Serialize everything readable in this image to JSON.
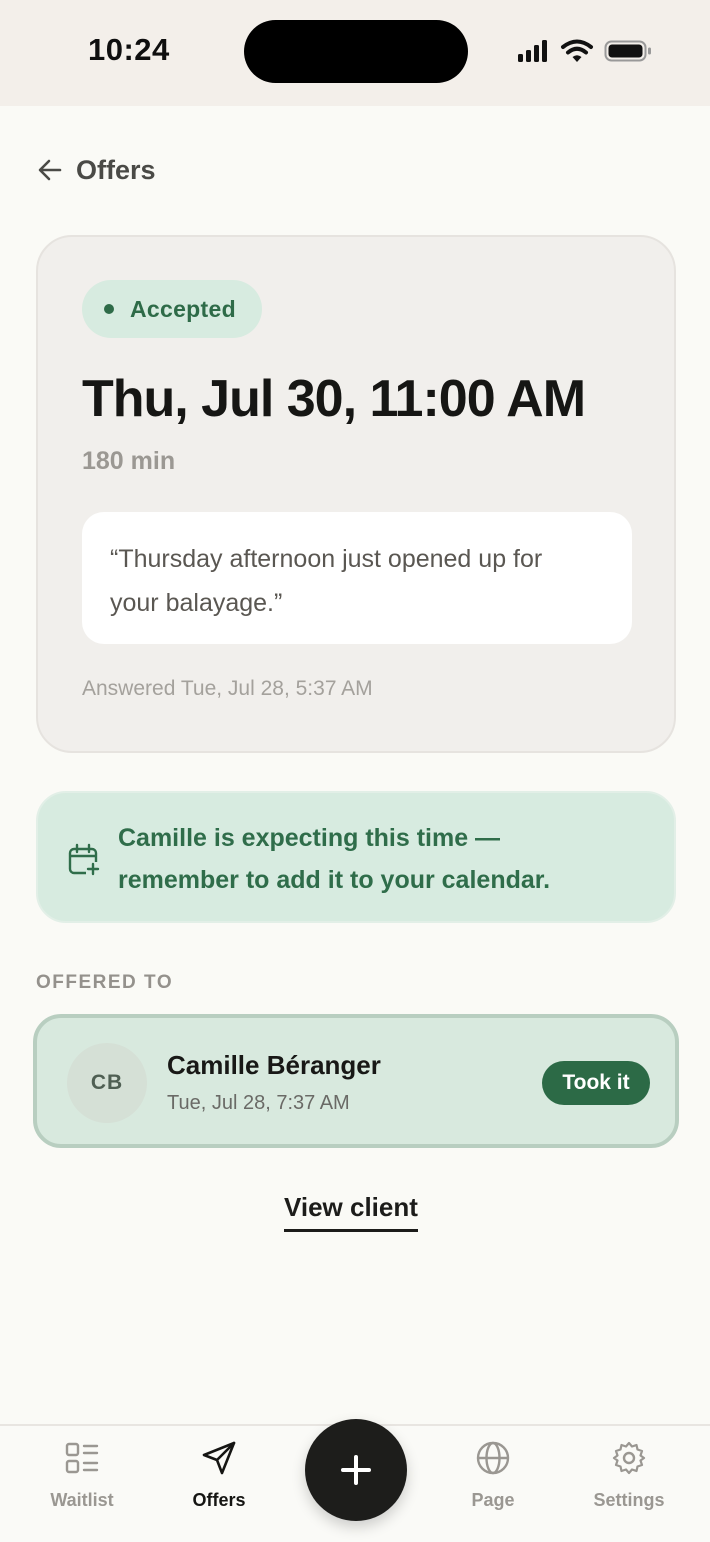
{
  "status_bar": {
    "time": "10:24",
    "icons": [
      "signal-icon",
      "wifi-icon",
      "battery-icon"
    ]
  },
  "nav": {
    "back_label": "Offers"
  },
  "offer": {
    "status": "Accepted",
    "datetime": "Thu, Jul 30, 11:00 AM",
    "duration": "180 min",
    "message_line1": "“Thursday afternoon just opened up for",
    "message_line2": "your balayage.”",
    "answered": "Answered Tue, Jul 28, 5:37 AM"
  },
  "reminder": {
    "icon": "calendar-plus-icon",
    "line1": "Camille is expecting this time —",
    "line2": "remember to add it to your calendar."
  },
  "offered_to": {
    "section_label": "OFFERED TO",
    "client": {
      "initials": "CB",
      "name": "Camille Béranger",
      "time": "Tue, Jul 28, 7:37 AM",
      "badge": "Took it"
    },
    "view_client_label": "View client"
  },
  "tab_bar": {
    "tabs": [
      {
        "label": "Waitlist",
        "icon": "list-icon",
        "active": false
      },
      {
        "label": "Offers",
        "icon": "send-icon",
        "active": true
      },
      {
        "label": "Page",
        "icon": "globe-icon",
        "active": false
      },
      {
        "label": "Settings",
        "icon": "gear-icon",
        "active": false
      }
    ],
    "fab_icon": "plus-icon"
  },
  "colors": {
    "accent_green": "#2e6b48",
    "pill_green_bg": "#d7ebe0",
    "background": "#fafaf6",
    "card_bg": "#f1efec"
  }
}
